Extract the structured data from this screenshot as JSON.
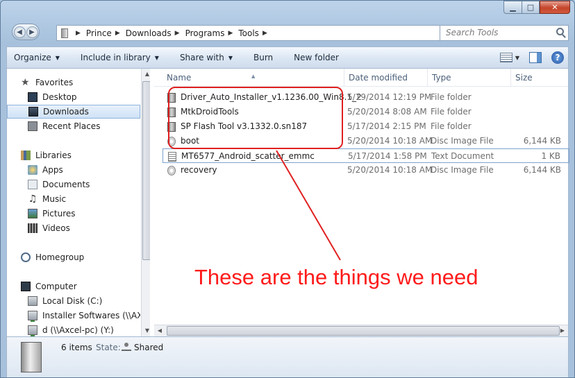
{
  "window": {
    "minimize_glyph": "▁",
    "maximize_glyph": "□",
    "close_glyph": "✕"
  },
  "nav": {
    "back_glyph": "◀",
    "forward_glyph": "▶"
  },
  "address": {
    "crumbs": [
      "Prince",
      "Downloads",
      "Programs",
      "Tools"
    ],
    "separator": "▶"
  },
  "search": {
    "placeholder": "Search Tools"
  },
  "toolbar": {
    "organize": "Organize",
    "include_in_library": "Include in library",
    "share_with": "Share with",
    "burn": "Burn",
    "new_folder": "New folder",
    "help_glyph": "?",
    "dropdown_glyph": "▼"
  },
  "sidebar": {
    "favorites": "Favorites",
    "desktop": "Desktop",
    "downloads": "Downloads",
    "recent_places": "Recent Places",
    "libraries": "Libraries",
    "apps": "Apps",
    "documents": "Documents",
    "music": "Music",
    "pictures": "Pictures",
    "videos": "Videos",
    "homegroup": "Homegroup",
    "computer": "Computer",
    "local_disk": "Local Disk (C:)",
    "installer_softwares": "Installer Softwares (\\\\AXCE",
    "d_drive": "d (\\\\Axcel-pc) (Y:)",
    "music_glyph": "♫",
    "star_glyph": "★",
    "up_glyph": "▲",
    "down_glyph": "▼"
  },
  "columns": {
    "name": "Name",
    "date_modified": "Date modified",
    "type": "Type",
    "size": "Size",
    "sort_glyph": "▲"
  },
  "files": [
    {
      "name": "Driver_Auto_Installer_v1.1236.00_Win8.1_2",
      "date": "5/19/2014 12:19 PM",
      "type": "File folder",
      "size": "",
      "icon": "folder-icon"
    },
    {
      "name": "MtkDroidTools",
      "date": "5/20/2014 8:08 AM",
      "type": "File folder",
      "size": "",
      "icon": "folder-icon"
    },
    {
      "name": "SP Flash Tool v3.1332.0.sn187",
      "date": "5/17/2014 2:15 PM",
      "type": "File folder",
      "size": "",
      "icon": "folder-icon"
    },
    {
      "name": "boot",
      "date": "5/20/2014 10:18 AM",
      "type": "Disc Image File",
      "size": "6,144 KB",
      "icon": "disc-image-icon"
    },
    {
      "name": "MT6577_Android_scatter_emmc",
      "date": "5/17/2014 1:58 PM",
      "type": "Text Document",
      "size": "1 KB",
      "icon": "text-document-icon"
    },
    {
      "name": "recovery",
      "date": "5/20/2014 10:18 AM",
      "type": "Disc Image File",
      "size": "6,144 KB",
      "icon": "disc-image-icon"
    }
  ],
  "annotation": {
    "text": "These are the things we need",
    "color": "#ff1a1a"
  },
  "hscroll": {
    "left_glyph": "◀",
    "right_glyph": "▶"
  },
  "details": {
    "count": "6 items",
    "state_label": "State:",
    "state_value": "Shared"
  }
}
